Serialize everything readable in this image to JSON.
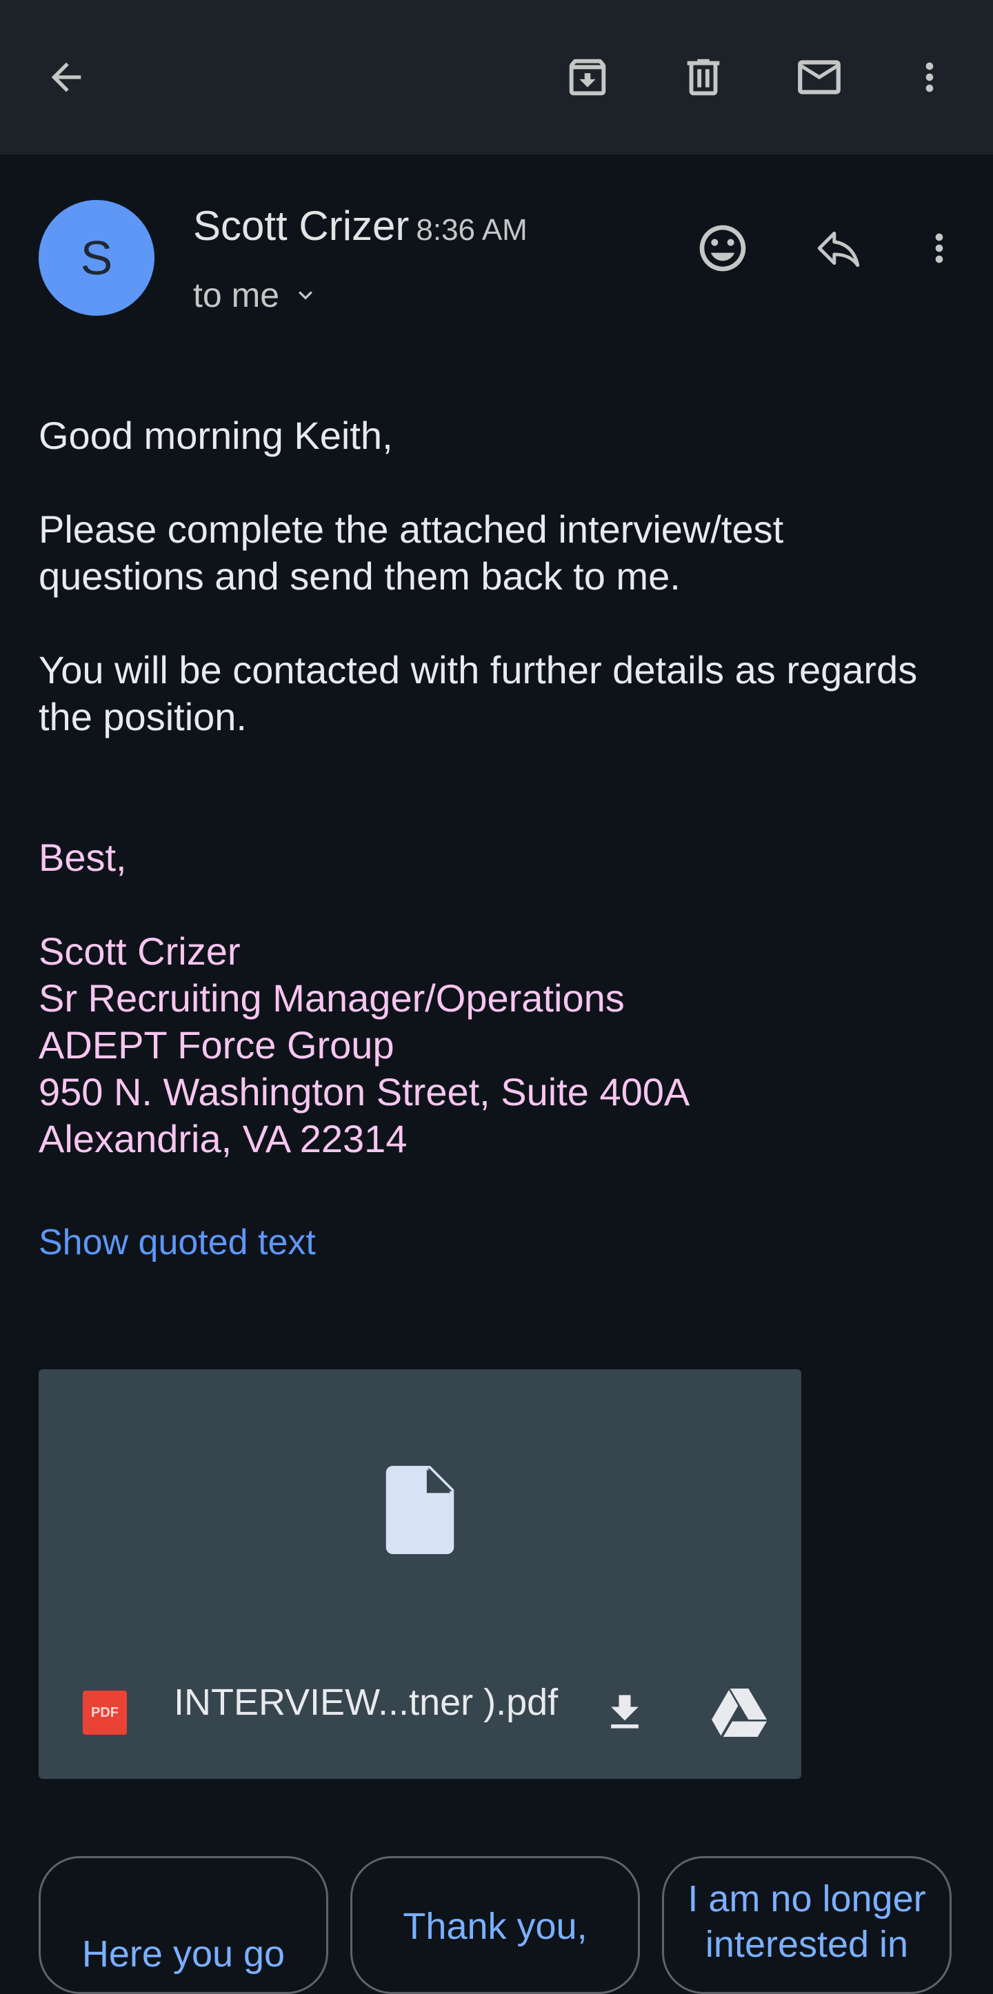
{
  "toolbar": {
    "icons": [
      "back-arrow-icon",
      "archive-icon",
      "delete-icon",
      "mark-unread-icon",
      "more-vert-icon"
    ]
  },
  "message": {
    "avatar_initial": "S",
    "sender": "Scott Crizer",
    "time": "8:36 AM",
    "recipient": "to me",
    "body": [
      "Good morning Keith,",
      "Please complete the attached interview/test",
      "questions and send them back to me.",
      "You will be contacted with further details as regards",
      "the position."
    ],
    "signature": [
      "Best,",
      "Scott Crizer",
      "Sr Recruiting Manager/Operations",
      "ADEPT Force Group",
      "950 N. Washington Street, Suite 400A",
      "Alexandria, VA 22314"
    ],
    "show_quoted": "Show quoted text"
  },
  "attachment": {
    "filename": "INTERVIEW...tner ).pdf",
    "badge": "PDF"
  },
  "smart_replies": [
    {
      "lines": [
        "Here you go"
      ]
    },
    {
      "lines": [
        "Thank you,"
      ]
    },
    {
      "lines": [
        "I am no longer",
        "interested in"
      ]
    }
  ],
  "colors": {
    "background": "#0e131a",
    "toolbar": "#1d2229",
    "avatar": "#5e97f6",
    "signature": "#f7c6f0",
    "link": "#5e97f6",
    "attachment_card": "#37454f",
    "pdf_badge": "#ea4335"
  }
}
